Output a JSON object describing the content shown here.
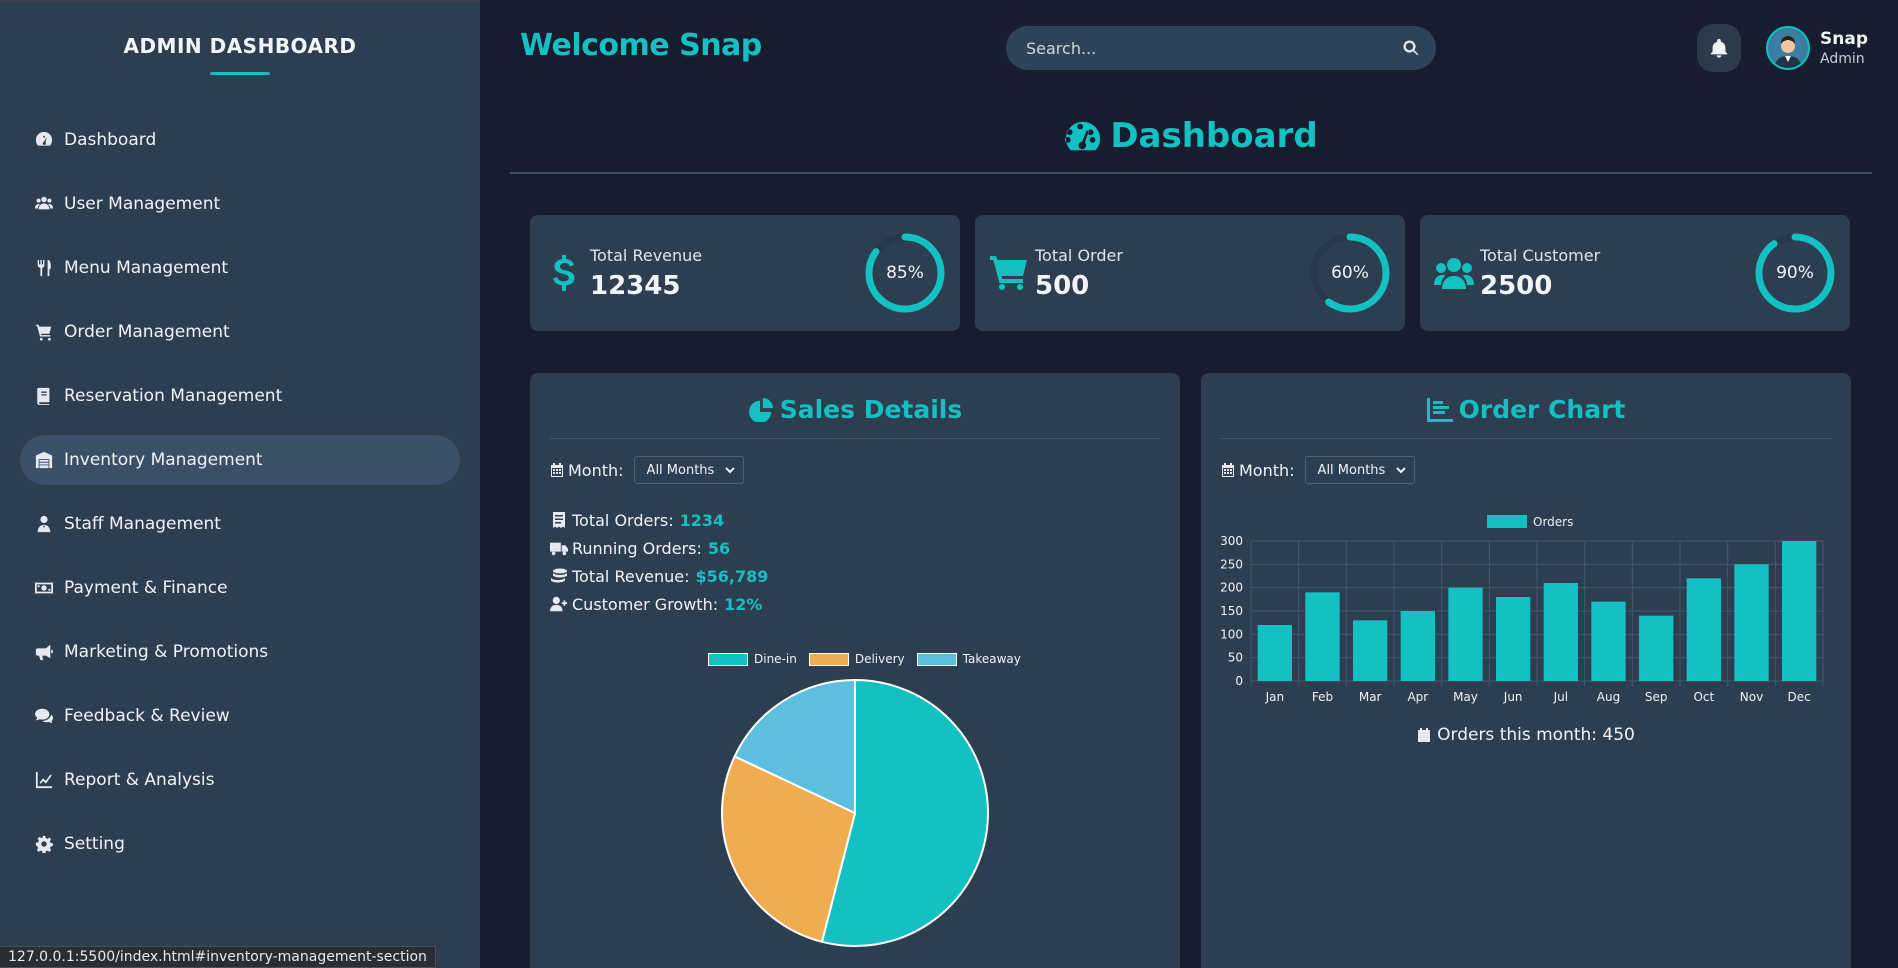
{
  "sidebar": {
    "title": "ADMIN DASHBOARD",
    "items": [
      {
        "label": "Dashboard",
        "icon": "gauge-icon"
      },
      {
        "label": "User Management",
        "icon": "users-icon"
      },
      {
        "label": "Menu Management",
        "icon": "utensils-icon"
      },
      {
        "label": "Order Management",
        "icon": "cart-icon"
      },
      {
        "label": "Reservation Management",
        "icon": "book-icon"
      },
      {
        "label": "Inventory Management",
        "icon": "warehouse-icon",
        "active": true
      },
      {
        "label": "Staff Management",
        "icon": "staff-icon"
      },
      {
        "label": "Payment & Finance",
        "icon": "money-icon"
      },
      {
        "label": "Marketing & Promotions",
        "icon": "megaphone-icon"
      },
      {
        "label": "Feedback & Review",
        "icon": "comments-icon"
      },
      {
        "label": "Report & Analysis",
        "icon": "line-chart-icon"
      },
      {
        "label": "Setting",
        "icon": "gear-icon"
      }
    ]
  },
  "header": {
    "welcome": "Welcome Snap",
    "search_placeholder": "Search...",
    "user_name": "Snap",
    "user_role": "Admin"
  },
  "dashboard": {
    "title": "Dashboard"
  },
  "stats": [
    {
      "label": "Total Revenue",
      "value": "12345",
      "percent_text": "85%",
      "percent": 85,
      "icon": "dollar-icon"
    },
    {
      "label": "Total Order",
      "value": "500",
      "percent_text": "60%",
      "percent": 60,
      "icon": "cart-icon"
    },
    {
      "label": "Total Customer",
      "value": "2500",
      "percent_text": "90%",
      "percent": 90,
      "icon": "users-icon"
    }
  ],
  "sales": {
    "title": "Sales Details",
    "month_label": "Month:",
    "month_value": "All Months",
    "metrics": [
      {
        "label": "Total Orders:",
        "value": "1234",
        "icon": "receipt-icon"
      },
      {
        "label": "Running Orders:",
        "value": "56",
        "icon": "truck-icon"
      },
      {
        "label": "Total Revenue:",
        "value": "$56,789",
        "icon": "coins-icon"
      },
      {
        "label": "Customer Growth:",
        "value": "12%",
        "icon": "user-plus-icon"
      }
    ]
  },
  "orders": {
    "title": "Order Chart",
    "month_label": "Month:",
    "month_value": "All Months",
    "footer": "Orders this month: 450"
  },
  "status_bar": "127.0.0.1:5500/index.html#inventory-management-section",
  "colors": {
    "accent": "#14c1c2",
    "orange": "#efad4f",
    "light_blue": "#5bbfdd",
    "panel": "#2d3e50",
    "background": "#171c2e"
  },
  "chart_data": [
    {
      "type": "pie",
      "categories": [
        "Dine-in",
        "Delivery",
        "Takeaway"
      ],
      "values": [
        54,
        28,
        18
      ],
      "colors": [
        "#14c1c2",
        "#efad4f",
        "#5bbfdd"
      ],
      "legend": "top"
    },
    {
      "type": "bar",
      "categories": [
        "Jan",
        "Feb",
        "Mar",
        "Apr",
        "May",
        "Jun",
        "Jul",
        "Aug",
        "Sep",
        "Oct",
        "Nov",
        "Dec"
      ],
      "series": [
        {
          "name": "Orders",
          "values": [
            120,
            190,
            130,
            150,
            200,
            180,
            210,
            170,
            140,
            220,
            250,
            300
          ]
        }
      ],
      "ylim": [
        0,
        300
      ],
      "yticks": [
        0,
        50,
        100,
        150,
        200,
        250,
        300
      ],
      "grid": true,
      "legend": "top"
    }
  ]
}
